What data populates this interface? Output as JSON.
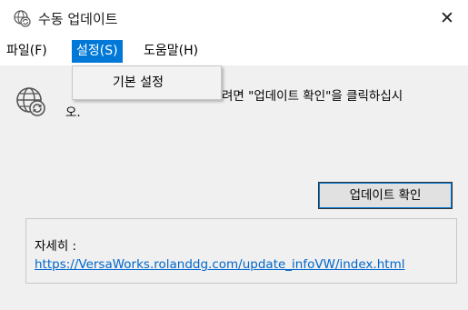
{
  "window": {
    "title": "수동 업데이트",
    "close_glyph": "✕",
    "icon": "globe-refresh-icon"
  },
  "menu": {
    "items": [
      {
        "label": "파일(F)"
      },
      {
        "label": "설정(S)",
        "active": true
      },
      {
        "label": "도움말(H)"
      }
    ],
    "dropdown": {
      "items": [
        {
          "label": "기본 설정"
        }
      ]
    }
  },
  "main": {
    "icon": "globe-refresh-icon",
    "instruction_visible": "하려면 \"업데이트 확인\"을 클릭하십시오.",
    "instruction_line1_tail": "려면 \"업데이트 확인\"을 클릭하십시",
    "instruction_line2": "오.",
    "check_button_label": "업데이트 확인",
    "details_label": "자세히 :",
    "details_link": "https://VersaWorks.rolanddg.com/update_infoVW/index.html"
  },
  "colors": {
    "accent": "#0078d7",
    "link": "#0066cc",
    "panel_bg": "#f0f0f0"
  }
}
